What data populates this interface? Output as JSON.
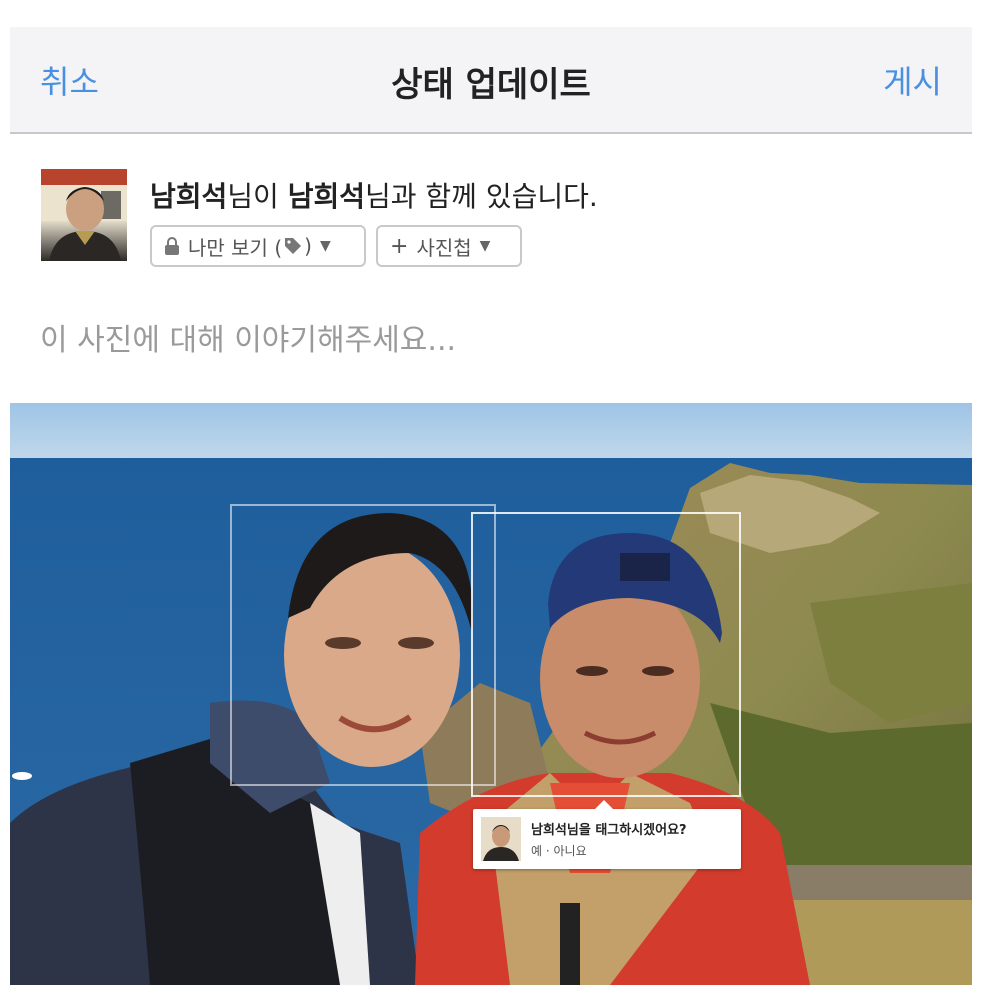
{
  "navbar": {
    "cancel_label": "취소",
    "title": "상태 업데이트",
    "post_label": "게시"
  },
  "header": {
    "user_name": "남희석",
    "suffix_1": "님이 ",
    "tagged_name": "남희석",
    "suffix_2": "님과 함께 있습니다."
  },
  "audience": {
    "privacy_label": "나만 보기 (",
    "privacy_close": ")",
    "lock_icon": "lock-icon",
    "tag_icon": "tag-icon",
    "album_plus": "+",
    "album_label": "사진첩"
  },
  "composer": {
    "placeholder": "이 사진에 대해 이야기해주세요..."
  },
  "tag_suggestion": {
    "question": "남희석님을 태그하시겠어요?",
    "yes": "예",
    "separator": " · ",
    "no": "아니요"
  },
  "colors": {
    "link_blue": "#4a90e2",
    "nav_bg": "#f4f4f6",
    "placeholder_gray": "#9a9a9a"
  }
}
